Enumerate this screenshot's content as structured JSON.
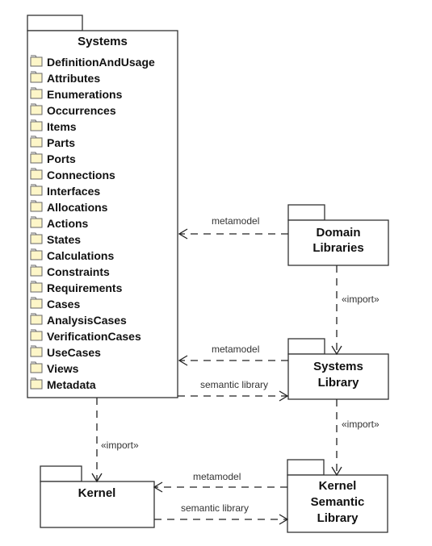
{
  "packages": {
    "systems": {
      "title": "Systems",
      "items": [
        "DefinitionAndUsage",
        "Attributes",
        "Enumerations",
        "Occurrences",
        "Items",
        "Parts",
        "Ports",
        "Connections",
        "Interfaces",
        "Allocations",
        "Actions",
        "States",
        "Calculations",
        "Constraints",
        "Requirements",
        "Cases",
        "AnalysisCases",
        "VerificationCases",
        "UseCases",
        "Views",
        "Metadata"
      ]
    },
    "domain_libraries": {
      "title_lines": [
        "Domain",
        "Libraries"
      ]
    },
    "systems_library": {
      "title_lines": [
        "Systems",
        "Library"
      ]
    },
    "kernel": {
      "title_lines": [
        "Kernel"
      ]
    },
    "kernel_semantic_library": {
      "title_lines": [
        "Kernel",
        "Semantic",
        "Library"
      ]
    }
  },
  "edges": {
    "domain_to_systems": "metamodel",
    "domain_import_systems_library": "«import»",
    "systems_library_to_systems": "metamodel",
    "systems_to_systems_library": "semantic library",
    "systems_library_import_kernel_sem": "«import»",
    "systems_import_kernel": "«import»",
    "kernel_sem_to_kernel": "metamodel",
    "kernel_to_kernel_sem": "semantic library"
  },
  "icons": {
    "item_icon": "folder-icon"
  },
  "colors": {
    "folder_fill": "#fdf6c8",
    "stroke": "#333333"
  }
}
